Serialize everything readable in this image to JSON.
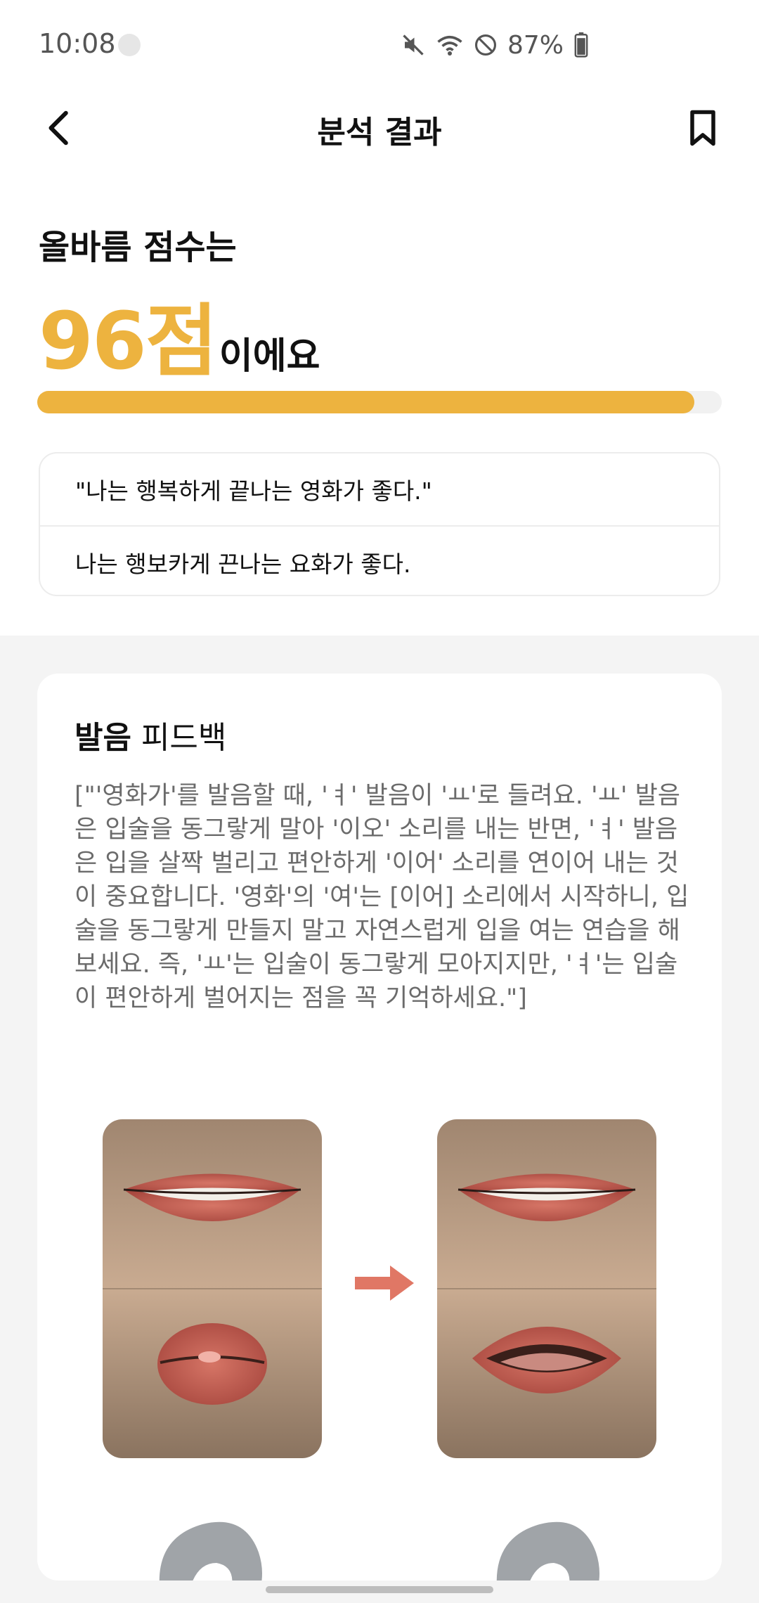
{
  "status_bar": {
    "time": "10:08",
    "battery": "87%",
    "icons": [
      "mute-icon",
      "wifi-icon",
      "do-not-disturb-icon",
      "battery-icon"
    ]
  },
  "app_bar": {
    "title": "분석 결과",
    "back_icon": "chevron-left-icon",
    "bookmark_icon": "bookmark-icon"
  },
  "score": {
    "caption": "올바름 점수는",
    "value": "96점",
    "suffix": "이에요",
    "progress_fraction": 0.96,
    "accent_color": "#EDB33F"
  },
  "sentences": {
    "target": "\"나는 행복하게 끝나는 영화가 좋다.\"",
    "recognized": "나는 행보카게 끈나는 요화가 좋다."
  },
  "feedback": {
    "title_bold": "발음",
    "title_rest": " 피드백",
    "body": "[\"'영화가'를 발음할 때, 'ㅕ' 발음이 'ㅛ'로 들려요. 'ㅛ' 발음은 입술을 동그랗게 말아 '이오' 소리를 내는 반면, 'ㅕ' 발음은 입을 살짝 벌리고 편안하게 '이어' 소리를 연이어 내는 것이 중요합니다. '영화'의 '여'는 [이어] 소리에서 시작하니, 입술을 동그랗게 만들지 말고 자연스럽게 입을 여는 연습을 해보세요. 즉, 'ㅛ'는 입술이 동그랗게 모아지지만, 'ㅕ'는 입술이 편안하게 벌어지는 점을 꼭 기억하세요.\"]",
    "arrow_color": "#E07765"
  }
}
